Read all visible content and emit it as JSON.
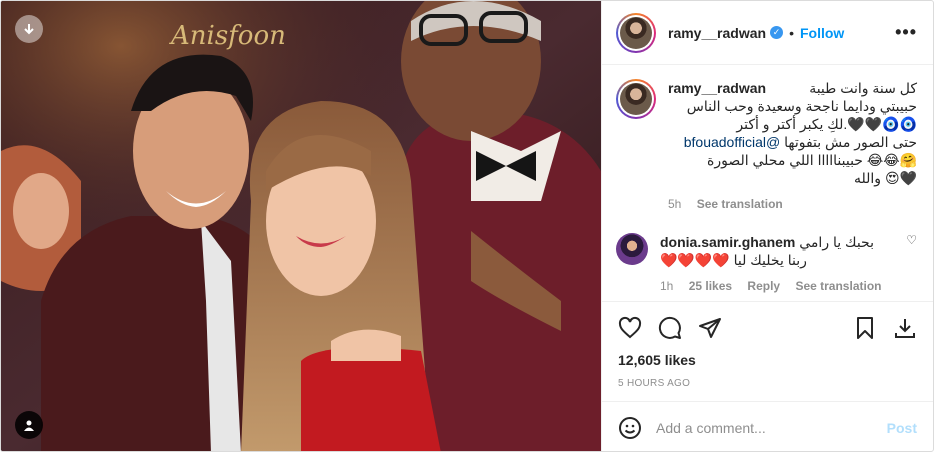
{
  "post": {
    "username": "ramy__radwan",
    "follow_label": "Follow",
    "more_label": "•••",
    "caption": {
      "line1": "كل سنة وانت طيبة",
      "line2": "حبيبتي ودايما ناجحة وسعيدة وحب الناس",
      "line3": "🧿🧿🖤🖤.لكِ يكبر أكتر و أكتر",
      "line4": "حتى الصور مش بتفوتها",
      "mention": "@bfouadofficial",
      "line5": "🤗😂😂 حبيبنااااا اللي محلي الصورة",
      "line6": "🖤😍 والله",
      "age": "5h",
      "see_translation": "See translation"
    },
    "comment": {
      "username": "donia.samir.ghanem",
      "text_line1": "بحبك يا رامي",
      "text_line2": "ربنا يخليك ليا ❤️❤️❤️❤️",
      "heart_label": "♡",
      "age": "1h",
      "likes": "25 likes",
      "reply": "Reply",
      "see_translation": "See translation"
    },
    "likes_label": "12,605 likes",
    "time_label": "5 HOURS AGO",
    "add_comment_placeholder": "Add a comment...",
    "post_label": "Post"
  },
  "photo": {
    "poster_text": "Anisfoon"
  },
  "icons": {
    "verified": "verified-badge-icon",
    "like": "heart-icon",
    "comment": "comment-icon",
    "share": "share-icon",
    "save": "bookmark-icon",
    "download": "download-icon",
    "emoji": "emoji-icon",
    "carousel": "arrow-down-icon",
    "tags": "user-tag-icon"
  }
}
